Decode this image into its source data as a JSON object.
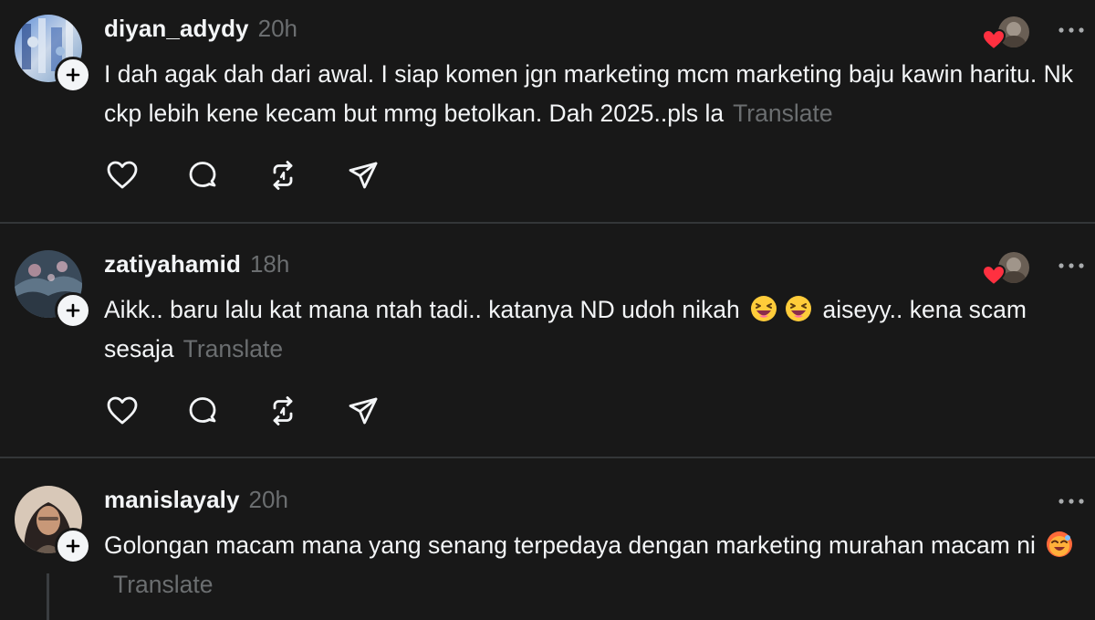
{
  "posts": [
    {
      "username": "diyan_adydy",
      "time": "20h",
      "text": "I dah agak dah dari awal. I siap komen jgn marketing mcm marketing baju kawin haritu. Nk ckp lebih kene kecam but mmg betolkan. Dah 2025..pls la",
      "translate": "Translate"
    },
    {
      "username": "zatiyahamid",
      "time": "18h",
      "text_part1": "Aikk.. baru lalu kat mana ntah tadi.. katanya ND udoh nikah",
      "text_part2": "aiseyy.. kena scam sesaja",
      "translate": "Translate"
    },
    {
      "username": "manislayaly",
      "time": "20h",
      "text_part1": "Golongan macam mana yang senang terpedaya dengan marketing murahan macam ni",
      "translate": "Translate"
    }
  ],
  "icons": {
    "like": "heart-icon",
    "reply": "comment-icon",
    "repost": "repost-icon",
    "share": "send-icon",
    "more": "more-dots-icon",
    "follow": "plus-icon"
  },
  "colors": {
    "background": "#181818",
    "text": "#f3f5f7",
    "muted": "#6b6e70",
    "divider": "#333638",
    "like_red": "#ff3040"
  }
}
